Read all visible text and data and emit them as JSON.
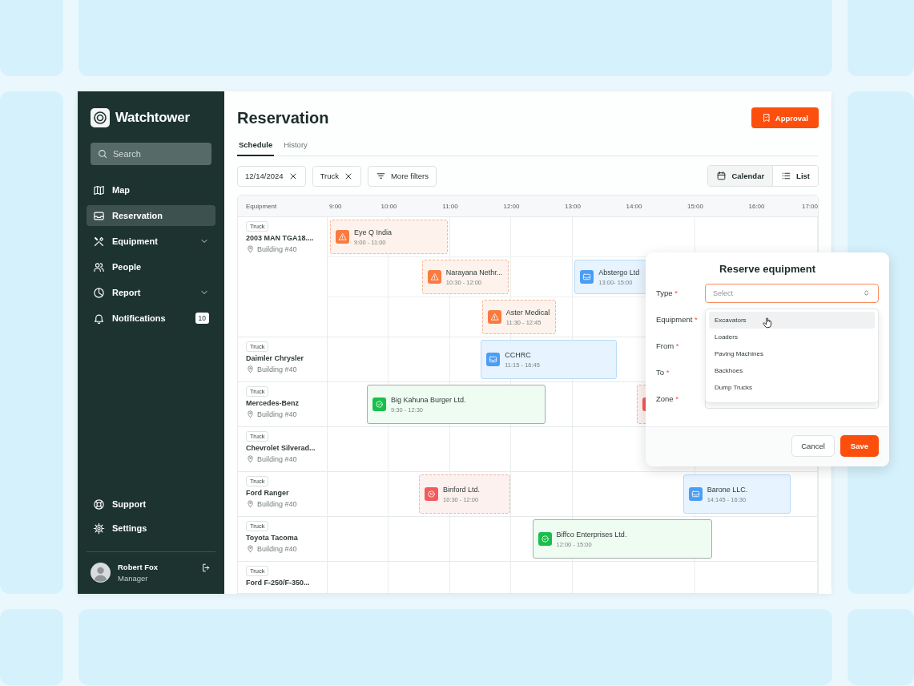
{
  "sidebar": {
    "brand": "Watchtower",
    "search": {
      "placeholder": "Search"
    },
    "items": [
      {
        "label": "Map",
        "selected": false
      },
      {
        "label": "Reservation",
        "selected": true
      },
      {
        "label": "Equipment",
        "selected": false,
        "submenu": true
      },
      {
        "label": "People",
        "selected": false
      },
      {
        "label": "Report",
        "selected": false,
        "submenu": true
      },
      {
        "label": "Notifications",
        "selected": false,
        "badge": "10"
      }
    ],
    "footer_items": [
      {
        "label": "Support"
      },
      {
        "label": "Settings"
      }
    ],
    "user": {
      "name": "Robert Fox",
      "role": "Manager"
    }
  },
  "page": {
    "title": "Reservation",
    "approval_button": "Approval",
    "tabs": [
      {
        "label": "Schedule",
        "selected": true
      },
      {
        "label": "History",
        "selected": false
      }
    ],
    "filters": [
      {
        "label": "12/14/2024",
        "kind": "chip"
      },
      {
        "label": "Truck",
        "kind": "chip"
      },
      {
        "label": "More filters",
        "kind": "menu"
      }
    ],
    "views": [
      {
        "label": "Calendar",
        "selected": true
      },
      {
        "label": "List",
        "selected": false
      }
    ]
  },
  "calendar": {
    "equipment_header": "Equipment",
    "hours": [
      "9:00",
      "10:00",
      "11:00",
      "12:00",
      "13:00",
      "14:00",
      "15:00",
      "16:00",
      "17:00"
    ],
    "rows": [
      {
        "tag": "Truck",
        "name": "2003 MAN TGA18....",
        "location": "Building #40",
        "lanes": [
          {
            "events": [
              {
                "kind": "warning",
                "title": "Eye Q India",
                "time": "9:00 - 11:00"
              }
            ]
          },
          {
            "events": [
              {
                "kind": "warning",
                "title": "Narayana Nethr...",
                "time": "10:30 - 12:00"
              },
              {
                "kind": "pending",
                "title": "Abstergo Ltd",
                "time": "13:00- 15:00"
              }
            ]
          },
          {
            "events": [
              {
                "kind": "warning",
                "title": "Aster Medical",
                "time": "11:30 - 12:45"
              }
            ]
          }
        ]
      },
      {
        "tag": "Truck",
        "name": "Daimler Chrysler",
        "location": "Building #40",
        "lanes": [
          {
            "events": [
              {
                "kind": "pending",
                "title": "CCHRC",
                "time": "11:15 - 16:45"
              }
            ]
          }
        ]
      },
      {
        "tag": "Truck",
        "name": "Mercedes-Benz",
        "location": "Building #40",
        "lanes": [
          {
            "events": [
              {
                "kind": "approved",
                "title": "Big Kahuna Burger Ltd.",
                "time": "9:30 - 12:30"
              },
              {
                "kind": "declined"
              }
            ]
          }
        ]
      },
      {
        "tag": "Truck",
        "name": "Chevrolet Silverad...",
        "location": "Building #40"
      },
      {
        "tag": "Truck",
        "name": "Ford Ranger",
        "location": "Building #40",
        "lanes": [
          {
            "events": [
              {
                "kind": "declined",
                "title": "Binford Ltd.",
                "time": "10:30 - 12:00"
              },
              {
                "kind": "pending",
                "title": "Barone LLC.",
                "time": "14:145 - 16:30"
              }
            ]
          }
        ]
      },
      {
        "tag": "Truck",
        "name": "Toyota Tacoma",
        "location": "Building #40",
        "lanes": [
          {
            "events": [
              {
                "kind": "approved",
                "title": "Biffco Enterprises Ltd.",
                "time": "12:00 - 15:00"
              }
            ]
          }
        ]
      },
      {
        "tag": "Truck",
        "name": "Ford F-250/F-350..."
      }
    ]
  },
  "modal": {
    "title": "Reserve equipment",
    "fields": [
      {
        "label": "Type",
        "mark": "*",
        "placeholder": "Select",
        "focused": true
      },
      {
        "label": "Equipment",
        "mark": "*"
      },
      {
        "label": "From",
        "mark": "*"
      },
      {
        "label": "To",
        "mark": "*"
      },
      {
        "label": "Zone",
        "mark": "*"
      }
    ],
    "options": [
      {
        "label": "Excavators",
        "hovered": true
      },
      {
        "label": "Loaders",
        "hovered": false
      },
      {
        "label": "Paving Machines",
        "hovered": false
      },
      {
        "label": "Backhoes",
        "hovered": false
      },
      {
        "label": "Dump Trucks",
        "hovered": false
      }
    ],
    "buttons": [
      {
        "label": "Cancel",
        "kind": "secondary"
      },
      {
        "label": "Save",
        "kind": "primary"
      }
    ]
  }
}
